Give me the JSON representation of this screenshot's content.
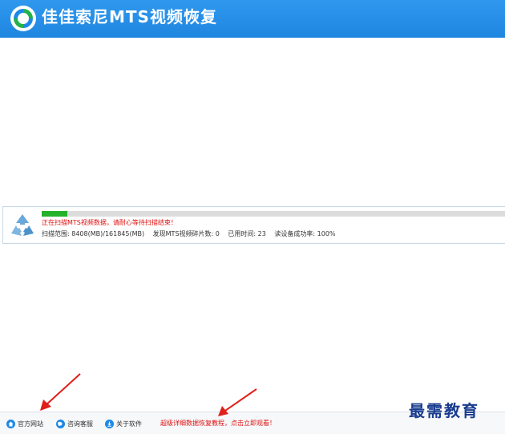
{
  "app": {
    "title": "佳佳索尼MTS视频恢复"
  },
  "scan": {
    "progress_fraction": 0.055,
    "status_message": "正在扫描MTS视频数据，请耐心等待扫描结束！",
    "range_label": "扫描范围:",
    "range_value": "8408(MB)/161845(MB)",
    "found_label": "发现MTS视频碎片数:",
    "found_value": "0",
    "elapsed_label": "已用时间:",
    "elapsed_value": "23",
    "read_success_label": "读设备成功率:",
    "read_success_value": "100%"
  },
  "footer": {
    "links": [
      {
        "label": "官方网站",
        "icon": "home-icon"
      },
      {
        "label": "咨询客服",
        "icon": "chat-icon"
      },
      {
        "label": "关于软件",
        "icon": "info-icon"
      }
    ],
    "promo": "超级详细数据恢复教程，点击立即观看！"
  },
  "watermark": "最需教育",
  "colors": {
    "titlebar": "#2f98ee",
    "progress": "#24b22a",
    "alert_text": "#e01010",
    "annotation_arrow": "#e0201a"
  }
}
